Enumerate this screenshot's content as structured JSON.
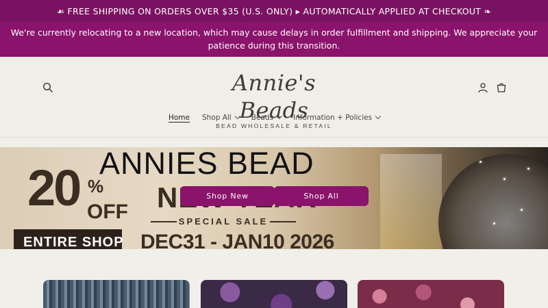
{
  "announcement": {
    "text": "☙ FREE SHIPPING ON ORDERS OVER $35 (U.S. ONLY) ▸ AUTOMATICALLY APPLIED AT CHECKOUT ❧"
  },
  "notice": {
    "line1": "We're currently relocating to a new location, which may cause delays in order fulfillment and shipping. We appreciate your",
    "line2": "patience during this transition."
  },
  "header": {
    "logo_title": "Annie's Beads",
    "logo_subtitle": "BEAD WHOLESALE & RETAIL",
    "icons": {
      "search": "search-icon",
      "account": "account-icon",
      "cart": "cart-icon"
    }
  },
  "nav": {
    "items": [
      {
        "label": "Home",
        "active": true
      },
      {
        "label": "Shop All",
        "dropdown": true
      },
      {
        "label": "Beads",
        "dropdown": true
      },
      {
        "label": "Information + Policies",
        "dropdown": true
      }
    ]
  },
  "hero": {
    "brand": "ANNIES BEAD",
    "pct": "20",
    "pct_sign": "%",
    "off": "OFF",
    "entire_shop": "ENTIRE SHOP",
    "headline": "NEW YEAR",
    "special": "SPECIAL SALE",
    "dates": "DEC31 - JAN10 2026",
    "buttons": [
      {
        "label": "Shop New"
      },
      {
        "label": "Shop All"
      }
    ]
  },
  "colors": {
    "primary": "#8a136b",
    "topbar": "#7b1261",
    "background": "#f1efe9"
  }
}
